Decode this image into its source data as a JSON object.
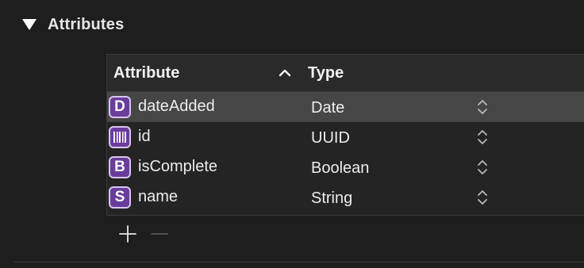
{
  "section": {
    "title": "Attributes",
    "expanded": true
  },
  "table": {
    "columns": {
      "attribute": "Attribute",
      "type": "Type"
    },
    "sort": "ascending",
    "rows": [
      {
        "badge": "D",
        "badge_icon": "letter",
        "name": "dateAdded",
        "type": "Date",
        "selected": true
      },
      {
        "badge": "",
        "badge_icon": "barcode-icon",
        "name": "id",
        "type": "UUID",
        "selected": false
      },
      {
        "badge": "B",
        "badge_icon": "letter",
        "name": "isComplete",
        "type": "Boolean",
        "selected": false
      },
      {
        "badge": "S",
        "badge_icon": "letter",
        "name": "name",
        "type": "String",
        "selected": false
      }
    ]
  },
  "toolbar": {
    "add_icon": "plus-icon",
    "remove_icon": "minus-icon",
    "remove_enabled": false
  },
  "colors": {
    "background": "#1e1e1e",
    "selected_row": "#464646",
    "badge_fill": "#6a3c9c",
    "badge_border": "#d7c6ee"
  }
}
